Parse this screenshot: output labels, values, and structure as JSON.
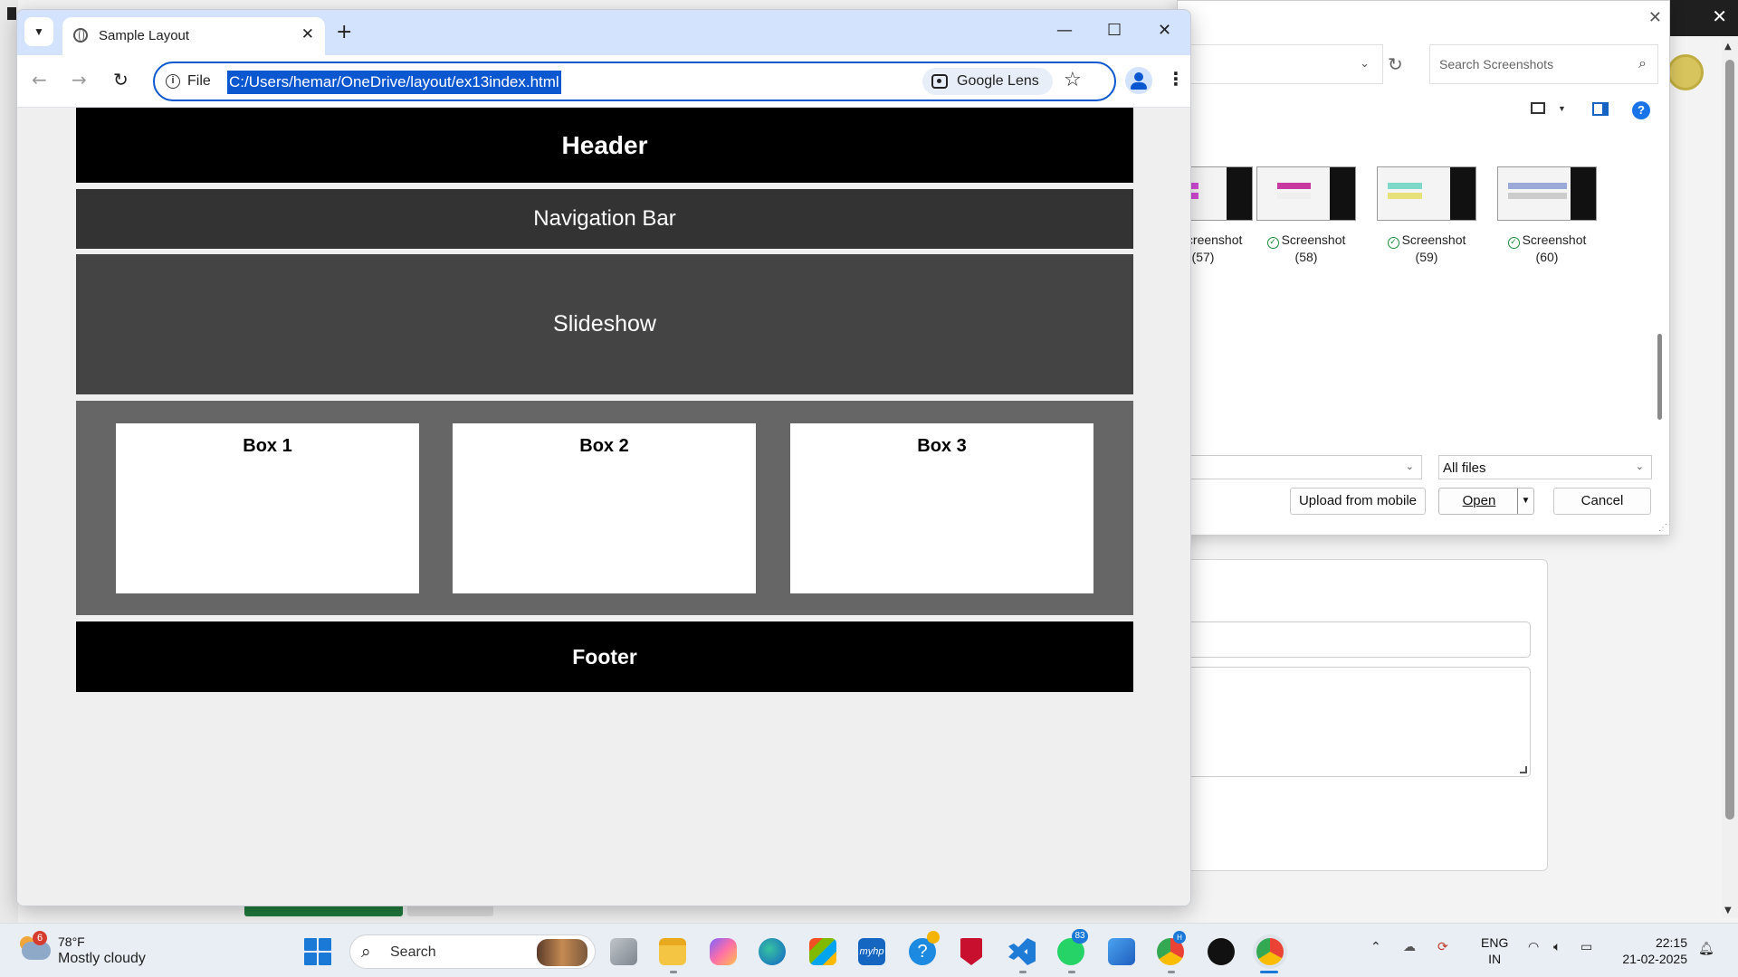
{
  "browser": {
    "tab_title": "Sample Layout",
    "url_scheme": "File",
    "url": "C:/Users/hemar/OneDrive/layout/ex13index.html",
    "lens_label": "Google Lens"
  },
  "page": {
    "header": "Header",
    "nav": "Navigation Bar",
    "slideshow": "Slideshow",
    "boxes": [
      "Box 1",
      "Box 2",
      "Box 3"
    ],
    "footer": "Footer"
  },
  "file_dialog": {
    "search_placeholder": "Search Screenshots",
    "files": [
      {
        "name": "Screenshot",
        "num": "(57)",
        "accent": "#d24ad6"
      },
      {
        "name": "Screenshot",
        "num": "(58)",
        "accent": "#c93aa0"
      },
      {
        "name": "Screenshot",
        "num": "(59)",
        "accent": "#7fd9c8"
      },
      {
        "name": "Screenshot",
        "num": "(60)",
        "accent": "#9aa9d8"
      }
    ],
    "filter": "All files",
    "upload_label": "Upload from mobile",
    "open_label": "Open",
    "cancel_label": "Cancel"
  },
  "taskbar": {
    "weather_badge": "6",
    "temperature": "78°F",
    "condition": "Mostly cloudy",
    "search_label": "Search",
    "whatsapp_badge": "83",
    "lang_line1": "ENG",
    "lang_line2": "IN",
    "time": "22:15",
    "date": "21-02-2025"
  },
  "colors": {
    "accent": "#0b57d0",
    "tabstrip": "#d3e3fd",
    "header_bg": "#000000",
    "nav_bg": "#333333",
    "slideshow_bg": "#444444",
    "boxes_bg": "#666666"
  }
}
